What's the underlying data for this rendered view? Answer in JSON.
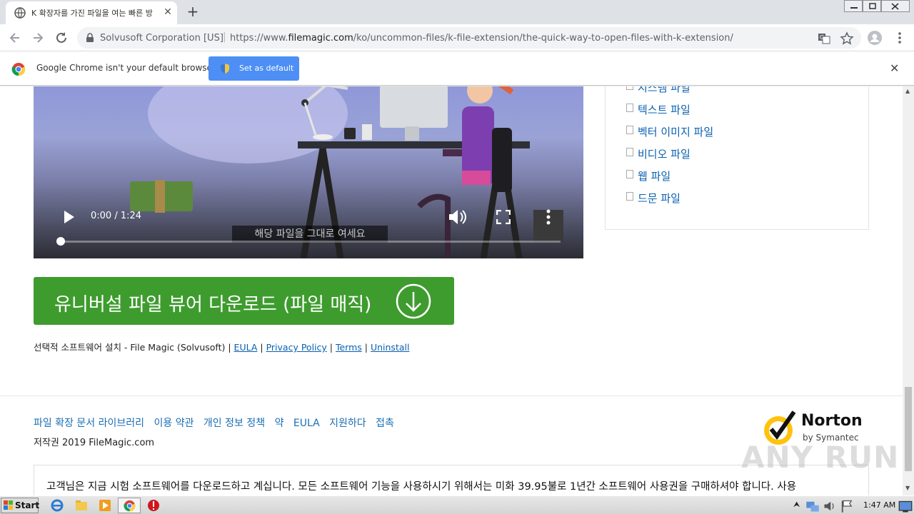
{
  "tab": {
    "title": "K 확장자를 가진 파일을 여는 빠른 방",
    "close_icon": "close-icon"
  },
  "omnibox": {
    "site": "Solvusoft Corporation [US]",
    "url_prefix": "https://www.",
    "url_domain": "filemagic.com",
    "url_path": "/ko/uncommon-files/k-file-extension/the-quick-way-to-open-files-with-k-extension/"
  },
  "infobar": {
    "message": "Google Chrome isn't your default browser",
    "button": "Set as default"
  },
  "video": {
    "time": "0:00 / 1:24",
    "caption": "해당 파일을 그대로 여세요"
  },
  "sidebar": {
    "items": [
      {
        "label": "시스템 파일"
      },
      {
        "label": "텍스트 파일"
      },
      {
        "label": "벡터 이미지 파일"
      },
      {
        "label": "비디오 파일"
      },
      {
        "label": "웹 파일"
      },
      {
        "label": "드문 파일"
      }
    ]
  },
  "download": {
    "label": "유니버설 파일 뷰어 다운로드 (파일 매직)"
  },
  "legal": {
    "prefix": "선택적 소프트웨어 설치 - File Magic (Solvusoft) |",
    "eula": "EULA",
    "privacy": "Privacy Policy",
    "terms": "Terms",
    "uninstall": "Uninstall",
    "sep": "|"
  },
  "footer": {
    "links": [
      "파일 확장 문서 라이브러리",
      "이용 약관",
      "개인 정보 정책",
      "약",
      "EULA",
      "지원하다",
      "접촉"
    ],
    "copyright": "저작권 2019 FileMagic.com",
    "norton_brand": "Norton",
    "norton_sub": "by Symantec",
    "notice": "고객님은 지금 시험 소프트웨어를 다운로드하고 계십니다. 모든 소프트웨어 기능을 사용하시기 위해서는 미화 39.95불로 1년간 소프트웨어 사용권을 구매하셔야 합니다. 사용"
  },
  "taskbar": {
    "start": "Start",
    "clock": "1:47 AM"
  },
  "watermark": "ANY RUN"
}
